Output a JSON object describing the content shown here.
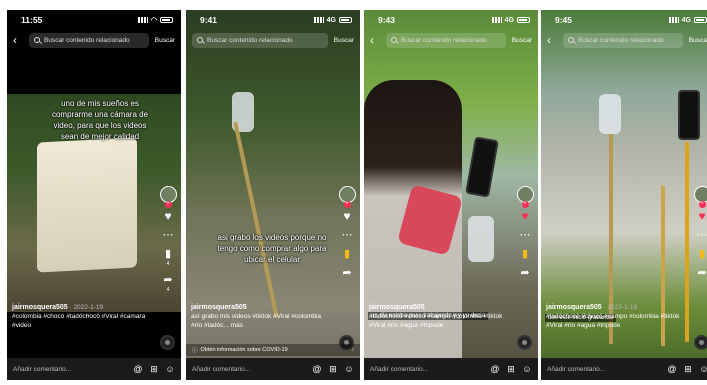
{
  "search": {
    "placeholder": "Buscar contenido relacionado",
    "button": "Buscar"
  },
  "comment_placeholder": "Añadir comentario...",
  "icons": {
    "back": "chevron-left-icon",
    "search": "search-icon",
    "mention": "at-icon",
    "gift": "gift-icon",
    "emoji": "emoji-icon",
    "like": "heart-icon",
    "comment": "comment-icon",
    "bookmark": "bookmark-icon",
    "share": "share-icon",
    "music": "music-disc-icon"
  },
  "colors": {
    "like_red": "#fe2c55",
    "bookmark_gold": "#f5b915",
    "comment_bar": "#1b1b1b"
  },
  "phones": [
    {
      "time": "11:55",
      "network": "",
      "overlay": "uno de mis sueños es comprarme una cámara de video, para que los videos sean de mejor calidad",
      "actions": {
        "likes": "",
        "comments": "",
        "saves": "4",
        "shares": "4"
      },
      "user": "jairmosquera505",
      "date": "· 2022-1-19",
      "caption": "#colombia #chocó #tadóchocó #Viral #camara #video"
    },
    {
      "time": "9:41",
      "network": "4G",
      "overlay": "asi grabo los videos porque no tengo como comprar algo para ubicar el celular",
      "user": "jairmosquera505",
      "date": "",
      "caption": "así grabo mis videos #tiktok #Viral #colombia #río #tadóc... más",
      "notice": "Obtén información sobre COVID-19"
    },
    {
      "time": "9:43",
      "network": "4G",
      "overlay": "un dia estaba pues trabajando y y yo decia",
      "user": "jairmosquera505",
      "date": "· 2023-1-18",
      "caption": "#tadóchocó #chocó #campo #colombia #tiktok #Viral #rio #agua #tripode"
    },
    {
      "time": "9:45",
      "network": "4G",
      "overlay": "con este inicié grabando",
      "user": "jairmosquera505",
      "date": "· 2023-1-19",
      "caption": "#tadóchocó #chocó #campo #colombia #tiktok #Viral #rio #agua #tripode"
    }
  ]
}
